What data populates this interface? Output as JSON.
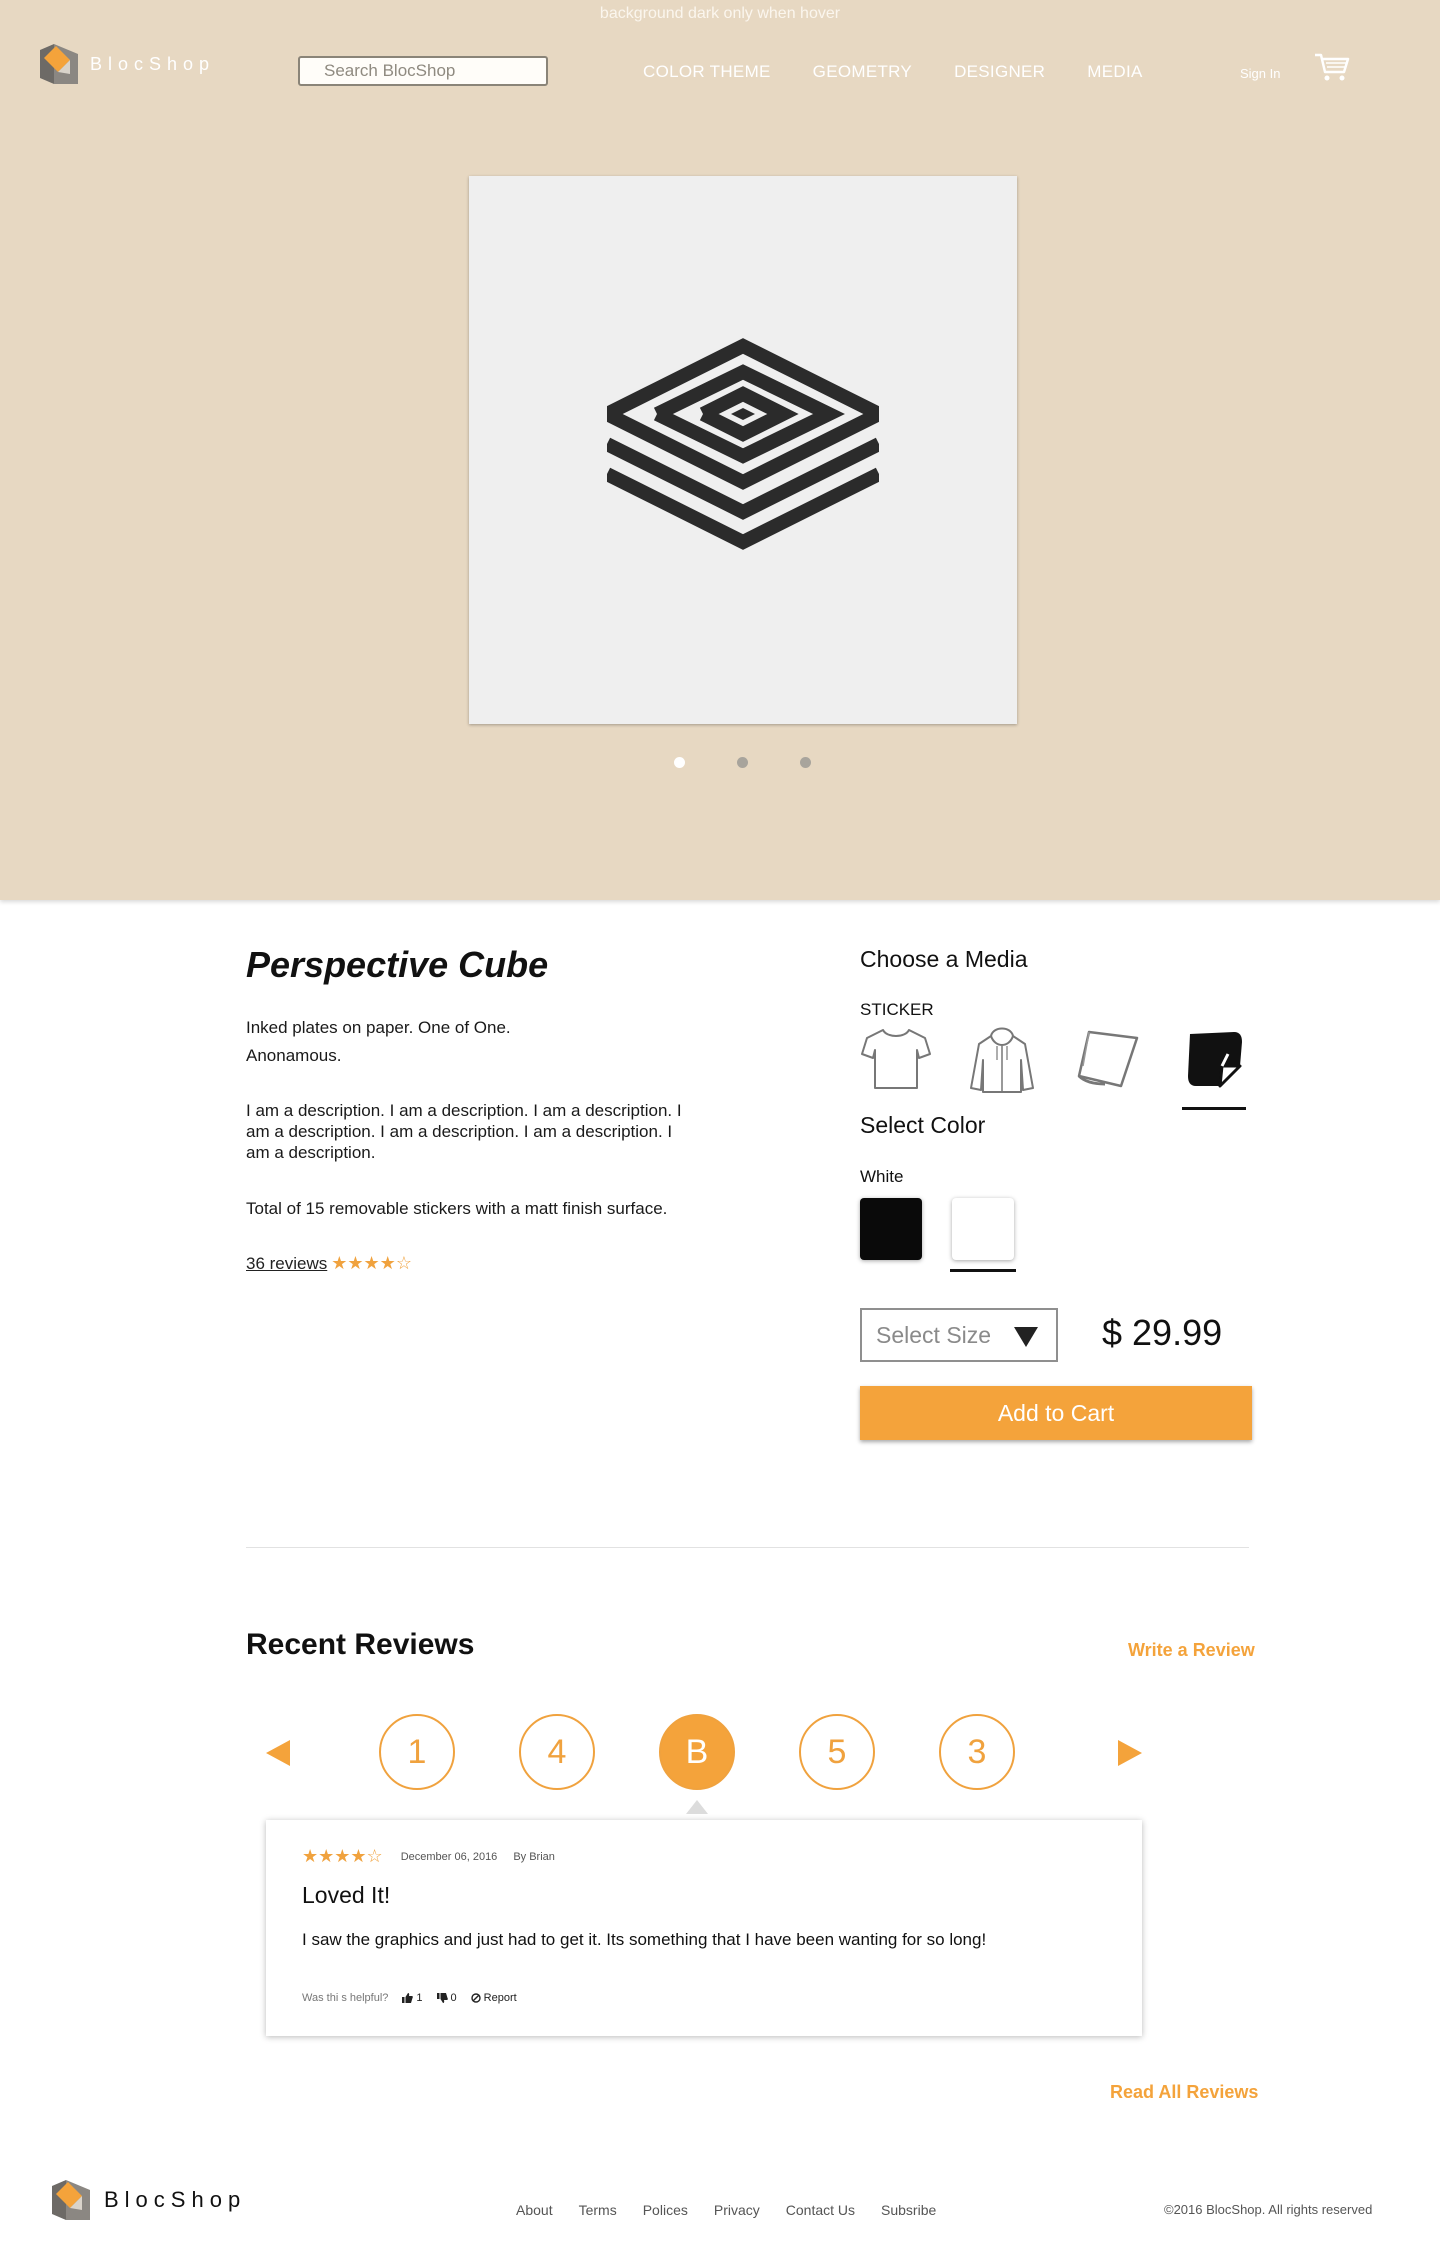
{
  "header": {
    "hover_note": "background dark only when hover",
    "logo_text": "BlocShop",
    "search_placeholder": "Search BlocShop",
    "nav": [
      "COLOR THEME",
      "GEOMETRY",
      "DESIGNER",
      "MEDIA"
    ],
    "sign_in": "Sign In"
  },
  "hero": {
    "active_slide": 1,
    "slide_count": 3
  },
  "product": {
    "title": "Perspective Cube",
    "byline_1": "Inked plates on paper. One of One.",
    "byline_2": "Anonamous.",
    "description": "I am a description. I am a description. I am a description. I am a description. I am a description. I am a description. I am a description.",
    "finish_note": "Total of 15 removable stickers with a matt finish surface.",
    "reviews_link": "36 reviews",
    "rating_stars": "★★★★☆"
  },
  "options": {
    "media_heading": "Choose a Media",
    "media_selected_label": "STICKER",
    "media": [
      {
        "icon": "tshirt-icon"
      },
      {
        "icon": "hoodie-icon"
      },
      {
        "icon": "paper-icon"
      },
      {
        "icon": "sticker-icon",
        "selected": true
      }
    ],
    "color_heading": "Select Color",
    "color_selected_label": "White",
    "colors": [
      {
        "name": "Black",
        "hex": "#0a0a0a"
      },
      {
        "name": "White",
        "hex": "#ffffff",
        "selected": true
      }
    ],
    "size_placeholder": "Select Size",
    "price": "$ 29.99",
    "add_to_cart": "Add to Cart"
  },
  "reviews": {
    "heading": "Recent Reviews",
    "write_review": "Write a Review",
    "pager": [
      "1",
      "4",
      "B",
      "5",
      "3"
    ],
    "active_index": 2,
    "card": {
      "stars": "★★★★☆",
      "date": "December 06, 2016",
      "author": "By Brian",
      "title": "Loved It!",
      "body": "I saw the graphics and just had to get it. Its something that I have been wanting for so long!",
      "helpful_prompt": "Was thi s helpful?",
      "likes": "1",
      "dislikes": "0",
      "report": "Report"
    },
    "read_all": "Read All Reviews"
  },
  "footer": {
    "logo_text": "BlocShop",
    "links": [
      "About",
      "Terms",
      "Polices",
      "Privacy",
      "Contact Us",
      "Subsribe"
    ],
    "copyright": "©2016 BlocShop. All rights reserved"
  },
  "colors": {
    "hero_bg": "#e7d8c2",
    "accent": "#f4a33b"
  }
}
